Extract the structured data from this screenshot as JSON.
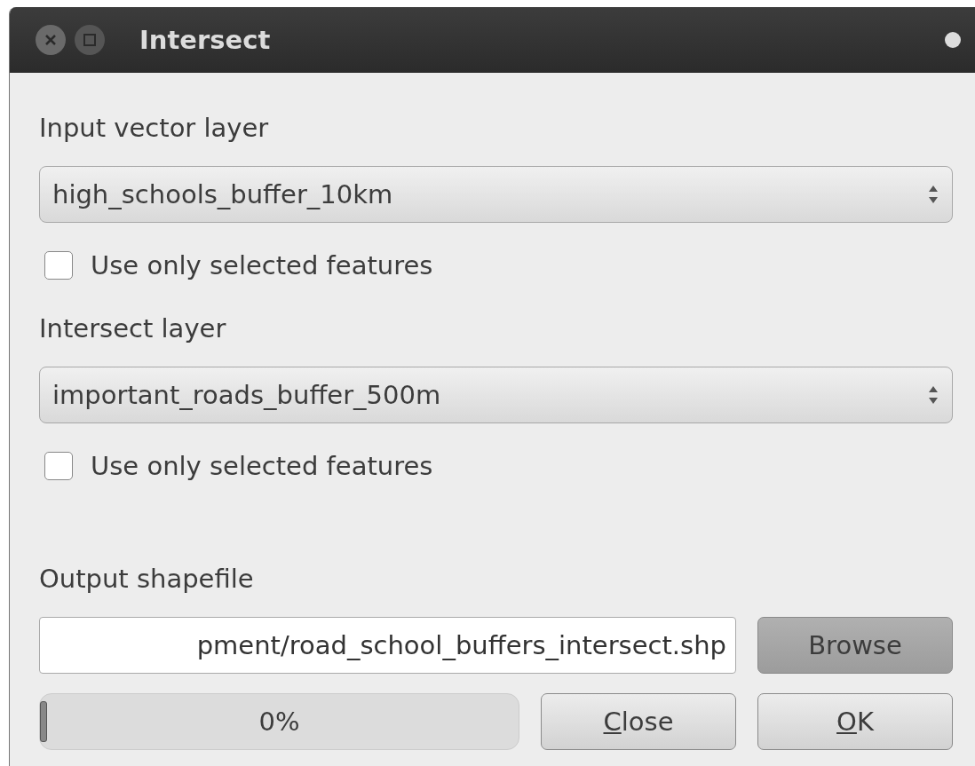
{
  "window": {
    "title": "Intersect"
  },
  "input_layer": {
    "label": "Input vector layer",
    "value": "high_schools_buffer_10km",
    "use_selected": {
      "label": "Use only selected features",
      "checked": false
    }
  },
  "intersect_layer": {
    "label": "Intersect layer",
    "value": "important_roads_buffer_500m",
    "use_selected": {
      "label": "Use only selected features",
      "checked": false
    }
  },
  "output": {
    "label": "Output shapefile",
    "value": "pment/road_school_buffers_intersect.shp",
    "browse": "Browse"
  },
  "progress": {
    "level": 0.0,
    "reading": "0%"
  },
  "buttons": [
    {
      "label": "Close",
      "mnemonic_underlined": true
    },
    {
      "label": "OK",
      "mnemonic_underlined": true
    }
  ]
}
